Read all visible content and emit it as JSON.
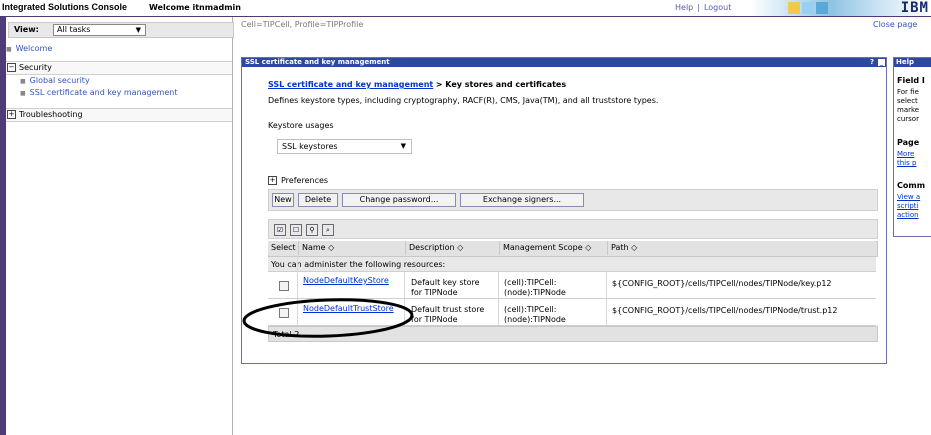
{
  "header": {
    "app_title": "Integrated Solutions Console",
    "welcome": "Welcome itnmadmin",
    "help_link": "Help",
    "separator": "|",
    "logout_link": "Logout",
    "logo": "IBM"
  },
  "nav": {
    "view_label": "View:",
    "view_value": "All tasks",
    "items": [
      {
        "label": "Welcome"
      },
      {
        "label": "Security",
        "expander": "−"
      },
      {
        "label": "Global security"
      },
      {
        "label": "SSL certificate and key management"
      },
      {
        "label": "Troubleshooting",
        "expander": "+"
      }
    ]
  },
  "main": {
    "breadcrumb": "Cell=TIPCell, Profile=TIPProfile",
    "close_page": "Close page",
    "panel_title": "SSL certificate and key management",
    "panel_help": "?",
    "panel_minimize": "_",
    "path_link": "SSL certificate and key management",
    "path_rest": "> Key stores and certificates",
    "description": "Defines keystore types, including cryptography, RACF(R), CMS, Java(TM), and all truststore types.",
    "keystore_usages_label": "Keystore usages",
    "keystore_usages_value": "SSL keystores",
    "preferences_label": "Preferences",
    "buttons": {
      "new": "New",
      "delete": "Delete",
      "change_password": "Change password...",
      "exchange_signers": "Exchange signers..."
    },
    "table": {
      "headers": [
        "Select",
        "Name ◇",
        "Description ◇",
        "Management Scope ◇",
        "Path ◇"
      ],
      "administer_note": "You can administer the following resources:",
      "rows": [
        {
          "name": "NodeDefaultKeyStore",
          "description_line1": "Default key store",
          "description_line2": "for TIPNode",
          "scope_line1": "(cell):TIPCell:",
          "scope_line2": "(node):TIPNode",
          "path": "${CONFIG_ROOT}/cells/TIPCell/nodes/TIPNode/key.p12"
        },
        {
          "name": "NodeDefaultTrustStore",
          "description_line1": "Default trust store",
          "description_line2": "for TIPNode",
          "scope_line1": "(cell):TIPCell:",
          "scope_line2": "(node):TIPNode",
          "path": "${CONFIG_ROOT}/cells/TIPCell/nodes/TIPNode/trust.p12"
        }
      ],
      "total": "Total 2"
    }
  },
  "help_panel": {
    "title": "Help",
    "field_heading": "Field I",
    "field_lines": [
      "For fie",
      "select",
      "marke",
      "cursor"
    ],
    "page_heading": "Page",
    "page_links": [
      "More",
      "this p"
    ],
    "command_heading": "Comm",
    "command_links": [
      "View a",
      "scripti",
      "action"
    ]
  },
  "colors": {
    "panel_title_bg": "#2b4a9e",
    "frame_purple": "#4e3c78",
    "link_blue": "#0033cc"
  }
}
